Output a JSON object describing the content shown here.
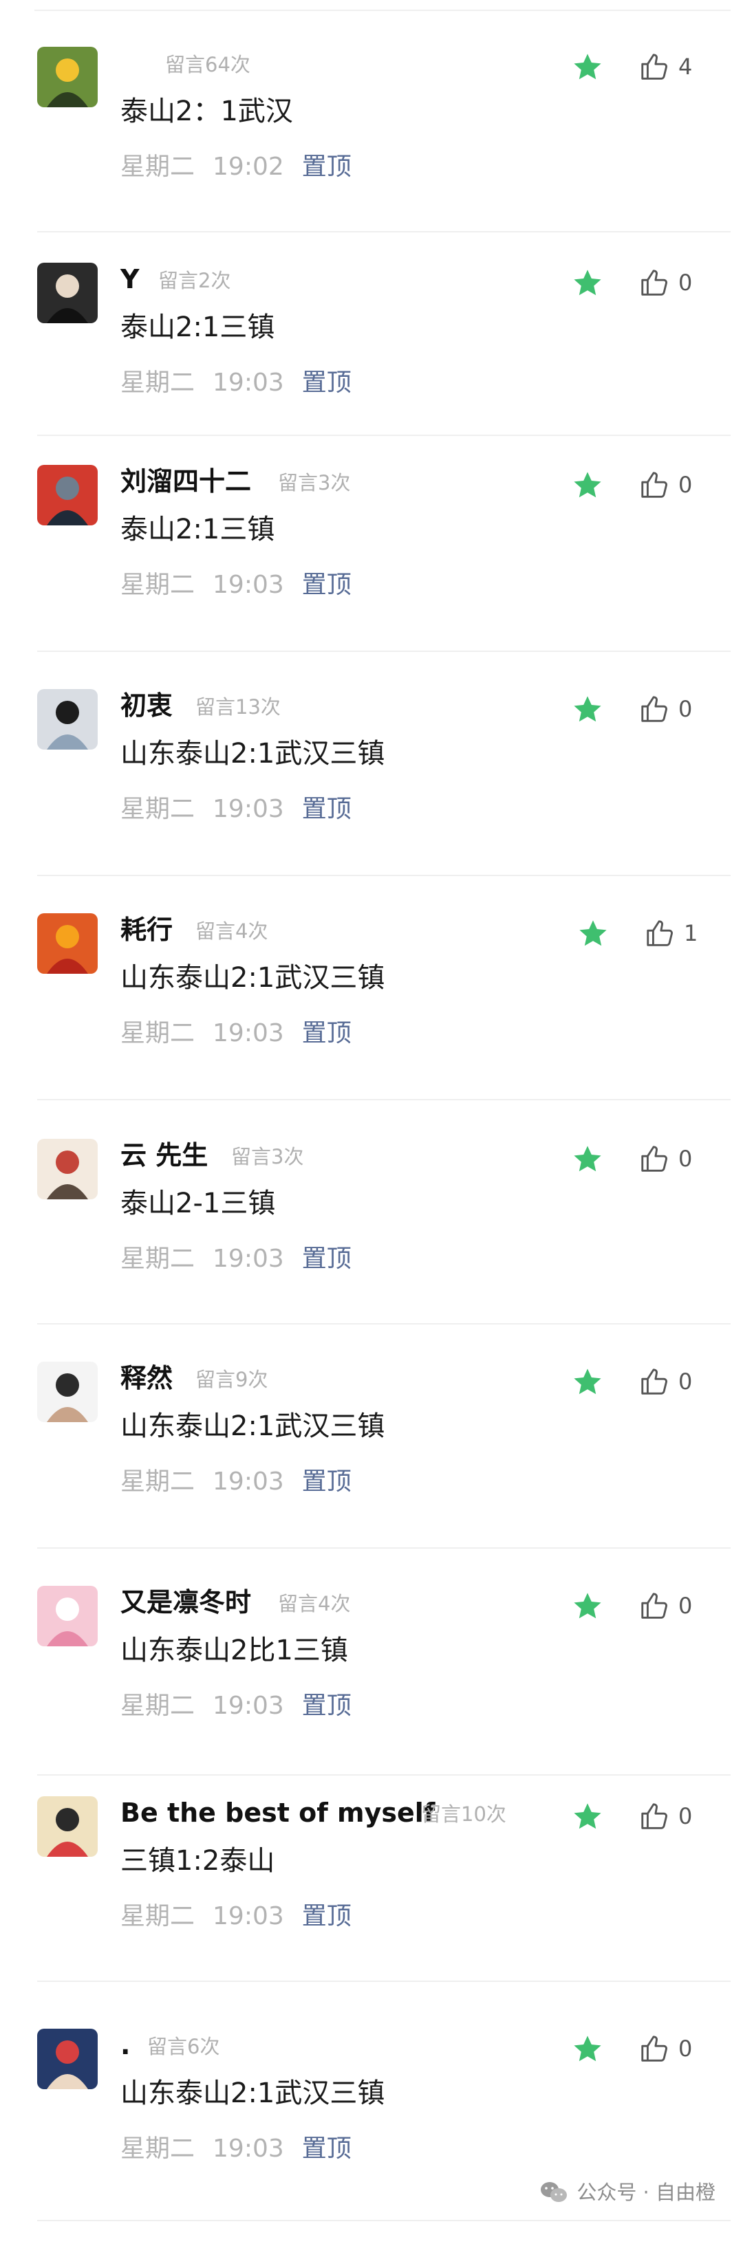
{
  "colors": {
    "star": "#3fbf6f",
    "pin_link": "#576b95",
    "muted": "#b3b3b3"
  },
  "comments": [
    {
      "nickname": "",
      "count": "留言64次",
      "text": "泰山2：1武汉",
      "day": "星期二",
      "time": "19:02",
      "pin": "置顶",
      "likes": "4",
      "avatar_icon": "avatar-photo"
    },
    {
      "nickname": "Y",
      "count": "留言2次",
      "text": "泰山2:1三镇",
      "day": "星期二",
      "time": "19:03",
      "pin": "置顶",
      "likes": "0",
      "avatar_icon": "avatar-photo"
    },
    {
      "nickname": "刘溜四十二",
      "count": "留言3次",
      "text": "泰山2:1三镇",
      "day": "星期二",
      "time": "19:03",
      "pin": "置顶",
      "likes": "0",
      "avatar_icon": "avatar-photo"
    },
    {
      "nickname": "初衷",
      "count": "留言13次",
      "text": "山东泰山2:1武汉三镇",
      "day": "星期二",
      "time": "19:03",
      "pin": "置顶",
      "likes": "0",
      "avatar_icon": "avatar-photo"
    },
    {
      "nickname": "耗行",
      "count": "留言4次",
      "text": "山东泰山2:1武汉三镇",
      "day": "星期二",
      "time": "19:03",
      "pin": "置顶",
      "likes": "1",
      "avatar_icon": "avatar-photo"
    },
    {
      "nickname": "云 先生",
      "count": "留言3次",
      "text": "泰山2-1三镇",
      "day": "星期二",
      "time": "19:03",
      "pin": "置顶",
      "likes": "0",
      "avatar_icon": "avatar-photo"
    },
    {
      "nickname": "释然",
      "count": "留言9次",
      "text": "山东泰山2:1武汉三镇",
      "day": "星期二",
      "time": "19:03",
      "pin": "置顶",
      "likes": "0",
      "avatar_icon": "avatar-photo"
    },
    {
      "nickname": "又是凛冬时",
      "count": "留言4次",
      "text": "山东泰山2比1三镇",
      "day": "星期二",
      "time": "19:03",
      "pin": "置顶",
      "likes": "0",
      "avatar_icon": "avatar-photo"
    },
    {
      "nickname": "Be the best of myself",
      "count": "留言10次",
      "text": "三镇1:2泰山",
      "day": "星期二",
      "time": "19:03",
      "pin": "置顶",
      "likes": "0",
      "avatar_icon": "avatar-photo"
    },
    {
      "nickname": ".",
      "count": "留言6次",
      "text": "山东泰山2:1武汉三镇",
      "day": "星期二",
      "time": "19:03",
      "pin": "置顶",
      "likes": "0",
      "avatar_icon": "avatar-photo"
    }
  ],
  "footer": {
    "text": "公众号 · 自由橙",
    "icon": "wechat-icon"
  }
}
